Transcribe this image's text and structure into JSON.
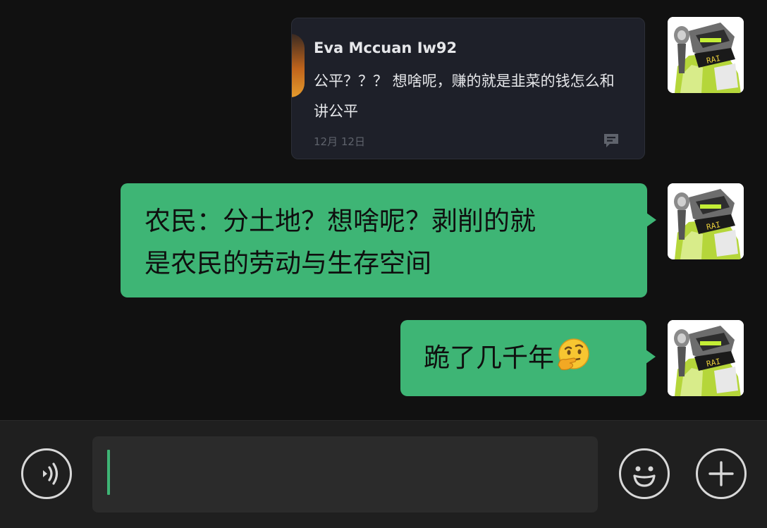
{
  "shared_post": {
    "author": "Eva Mccuan Iw92",
    "lines": [
      "公平？？？ 想啥呢，赚的就是韭菜的钱怎么和",
      "讲公平"
    ],
    "date": "12月 12日",
    "comment_icon": "comment-icon"
  },
  "messages": [
    {
      "lines": [
        "农民：分土地？想啥呢？剥削的就",
        "是农民的劳动与生存空间"
      ]
    },
    {
      "text": "跪了几千年",
      "emoji": "thinking-face-emoji"
    }
  ],
  "input_bar": {
    "voice_icon": "voice-icon",
    "text_value": "",
    "emoji_icon": "emoji-icon",
    "plus_icon": "plus-icon"
  },
  "colors": {
    "bubble": "#3eb575",
    "background": "#111111",
    "input_bar": "#1f1f1f",
    "card": "#1e2029"
  }
}
